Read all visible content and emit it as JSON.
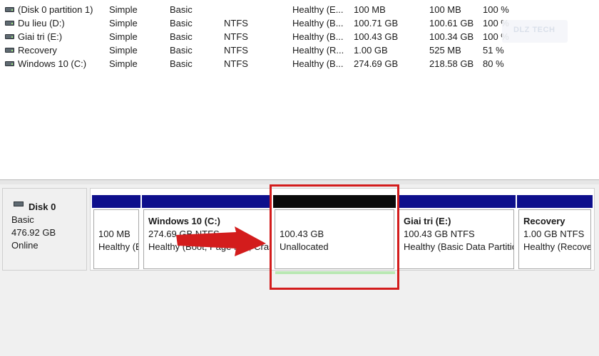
{
  "volumes": [
    {
      "name": "(Disk 0 partition 1)",
      "layout": "Simple",
      "type": "Basic",
      "fs": "",
      "status": "Healthy (E...",
      "capacity": "100 MB",
      "free": "100 MB",
      "pct": "100 %"
    },
    {
      "name": "Du lieu (D:)",
      "layout": "Simple",
      "type": "Basic",
      "fs": "NTFS",
      "status": "Healthy (B...",
      "capacity": "100.71 GB",
      "free": "100.61 GB",
      "pct": "100 %"
    },
    {
      "name": "Giai tri (E:)",
      "layout": "Simple",
      "type": "Basic",
      "fs": "NTFS",
      "status": "Healthy (B...",
      "capacity": "100.43 GB",
      "free": "100.34 GB",
      "pct": "100 %"
    },
    {
      "name": "Recovery",
      "layout": "Simple",
      "type": "Basic",
      "fs": "NTFS",
      "status": "Healthy (R...",
      "capacity": "1.00 GB",
      "free": "525 MB",
      "pct": "51 %"
    },
    {
      "name": "Windows 10 (C:)",
      "layout": "Simple",
      "type": "Basic",
      "fs": "NTFS",
      "status": "Healthy (B...",
      "capacity": "274.69 GB",
      "free": "218.58 GB",
      "pct": "80 %"
    }
  ],
  "watermark": {
    "text": "DLZ TECH"
  },
  "disk": {
    "name": "Disk 0",
    "type": "Basic",
    "size": "476.92 GB",
    "status": "Online",
    "partitions": [
      {
        "title": "",
        "line1": "100 MB",
        "line2": "Healthy (EFI System Partition)",
        "unallocated": false
      },
      {
        "title": "Windows 10  (C:)",
        "line1": "274.69 GB NTFS",
        "line2": "Healthy (Boot, Page File, Crash Dump, Basic Data Partition)",
        "unallocated": false
      },
      {
        "title": "",
        "line1": "100.43 GB",
        "line2": "Unallocated",
        "unallocated": true
      },
      {
        "title": "Giai tri  (E:)",
        "line1": "100.43 GB NTFS",
        "line2": "Healthy (Basic Data Partition)",
        "unallocated": false
      },
      {
        "title": "Recovery",
        "line1": "1.00 GB NTFS",
        "line2": "Healthy (Recovery Partition)",
        "unallocated": false
      }
    ]
  },
  "colors": {
    "primary_partition_bar": "#0e0f8c",
    "unallocated_bar": "#0a0a0a",
    "annotation_red": "#d31c1c",
    "selection_green": "#b9e8b3"
  },
  "icons": {
    "drive": "drive-icon",
    "disk": "disk-icon",
    "arrow": "arrow-right-icon"
  }
}
